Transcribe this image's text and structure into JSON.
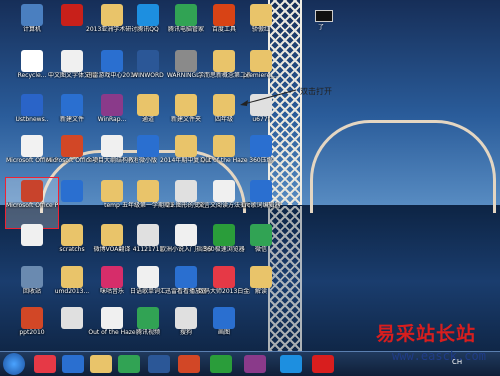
{
  "desktop": {
    "annotation": "双击打开",
    "top_widget_label": "了",
    "icons": [
      {
        "label": "计算机",
        "color": "#4a7fc0"
      },
      {
        "label": "Recycle...",
        "color": "#ffffff"
      },
      {
        "label": "Ustbnews..",
        "color": "#2a64c8"
      },
      {
        "label": "Microsoft Office Pow...",
        "color": "#f2f2f2"
      },
      {
        "label": "Microsoft Office Pow...",
        "color": "#c8432c"
      },
      {
        "label": "",
        "color": "#f0f0f0"
      },
      {
        "label": "回收站",
        "color": "#6a8ab0"
      },
      {
        "label": "ppt2010",
        "color": "#d24726"
      },
      {
        "label": "",
        "color": "#c8201a"
      },
      {
        "label": "中文图文字体文档",
        "color": "#f0f0f0"
      },
      {
        "label": "新建文件",
        "color": "#2a6fd0"
      },
      {
        "label": "Microsoft Office Po...",
        "color": "#d24726"
      },
      {
        "label": "",
        "color": "#2a6fd0"
      },
      {
        "label": "scratchs",
        "color": "#e9c46a"
      },
      {
        "label": "umd2013...",
        "color": "#e9c46a"
      },
      {
        "label": "",
        "color": "#e0e0e0"
      },
      {
        "label": "2013亚洲学术研讨会",
        "color": "#e9c46a"
      },
      {
        "label": "迅雷游戏中心2014",
        "color": "#2a6fd0"
      },
      {
        "label": "WinRap...",
        "color": "#8a3a8a"
      },
      {
        "label": "个项目大纲结构教程",
        "color": "#f0f0f0"
      },
      {
        "label": "temp",
        "color": "#e9c46a"
      },
      {
        "label": "微博VOA翻译",
        "color": "#e9c46a"
      },
      {
        "label": "咪咕音乐",
        "color": "#d62d6a"
      },
      {
        "label": "Out of the Haze",
        "color": "#f0f0f0"
      },
      {
        "label": "腾讯QQ",
        "color": "#1d8fe0"
      },
      {
        "label": "WINWORD",
        "color": "#2b5797"
      },
      {
        "label": "通道",
        "color": "#e9c46a"
      },
      {
        "label": "微小版",
        "color": "#2a6fd0"
      },
      {
        "label": "五年级第一学期期末",
        "color": "#e9c46a"
      },
      {
        "label": "41121711",
        "color": "#e0e0e0"
      },
      {
        "label": "日语歌单词汇",
        "color": "#f0f0f0"
      },
      {
        "label": "腾讯视频",
        "color": "#31a354"
      },
      {
        "label": "腾讯电脑管家",
        "color": "#31a354"
      },
      {
        "label": "WARNINGL...",
        "color": "#8a8a8a"
      },
      {
        "label": "新建文件夹",
        "color": "#e9c46a"
      },
      {
        "label": "2014年期中复习(11月6...",
        "color": "#e9c46a"
      },
      {
        "label": "21.图形的变化",
        "color": "#e0e0e0"
      },
      {
        "label": "欧洲小说入门指南资料",
        "color": "#f0f0f0"
      },
      {
        "label": "迅雷看看播放器",
        "color": "#2a6fd0"
      },
      {
        "label": "搜狗",
        "color": "#e0e0e0"
      },
      {
        "label": "百度工具",
        "color": "#d84315"
      },
      {
        "label": "学而思新概念第二册",
        "color": "#e9c46a"
      },
      {
        "label": "四年级",
        "color": "#e9c46a"
      },
      {
        "label": "Out of the Haze",
        "color": "#e9c46a"
      },
      {
        "label": "文言文阅读方法指导",
        "color": "#f0f0f0"
      },
      {
        "label": "360极速浏览器",
        "color": "#2a9d3a"
      },
      {
        "label": "数码大师2013白金版",
        "color": "#e63946"
      },
      {
        "label": "画图",
        "color": "#2a6fd0"
      },
      {
        "label": "骄傲红",
        "color": "#e9c46a"
      },
      {
        "label": "premiere_...",
        "color": "#e9c46a"
      },
      {
        "label": "u677f",
        "color": "#e0e0e0"
      },
      {
        "label": "360压缩",
        "color": "#2a6fd0"
      },
      {
        "label": "Lrc歌词编辑器",
        "color": "#2a6fd0"
      },
      {
        "label": "微信",
        "color": "#31a354"
      },
      {
        "label": "解读",
        "color": "#e9c46a"
      }
    ]
  },
  "taskbar": {
    "items": [
      "",
      "",
      "",
      "",
      "",
      "",
      "",
      "",
      "",
      ""
    ],
    "tray_text": "CH"
  },
  "watermark": {
    "title": "易采站长站",
    "url": "www.easck.com"
  }
}
